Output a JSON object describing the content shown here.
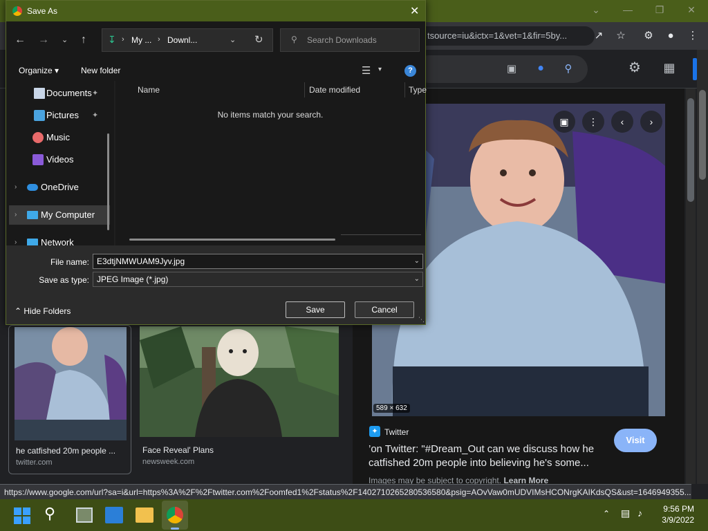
{
  "browser": {
    "omnibox_text": "tsource=iu&ictx=1&vet=1&fir=5by...",
    "status_url": "https://www.google.com/url?sa=i&url=https%3A%2F%2Ftwitter.com%2Foomfed1%2Fstatus%2F1402710265280536580&psig=AOvVaw0mUDVIMsHCONrgKAIKdsQS&ust=1646949355...",
    "accent_color": "#4a5e1a"
  },
  "results": [
    {
      "title": "he catfished 20m people ...",
      "source": "twitter.com"
    },
    {
      "title": "Face Reveal' Plans",
      "source": "newsweek.com"
    }
  ],
  "preview": {
    "dimensions": "589 × 632",
    "source_name": "Twitter",
    "title_line1": "’on Twitter: \"#Dream_Out can we discuss how he",
    "title_line2": "catfished 20m people into believing he's some...",
    "copyright_text": "Images may be subject to copyright.",
    "learn_more": "Learn More",
    "visit_label": "Visit"
  },
  "dialog": {
    "title": "Save As",
    "path": [
      "My ...",
      "Downl..."
    ],
    "search_placeholder": "Search Downloads",
    "organize_label": "Organize",
    "new_folder_label": "New folder",
    "nav_items": [
      {
        "label": "Documents",
        "icon": "documents-icon"
      },
      {
        "label": "Pictures",
        "icon": "pictures-icon"
      },
      {
        "label": "Music",
        "icon": "music-icon"
      },
      {
        "label": "Videos",
        "icon": "videos-icon"
      },
      {
        "label": "OneDrive",
        "icon": "onedrive-icon"
      },
      {
        "label": "My Computer",
        "icon": "computer-icon"
      },
      {
        "label": "Network",
        "icon": "network-icon"
      }
    ],
    "columns": [
      "Name",
      "Date modified",
      "Type"
    ],
    "empty_message": "No items match your search.",
    "file_name_label": "File name:",
    "file_name_value": "E3dtjNMWUAM9Jyv.jpg",
    "save_type_label": "Save as type:",
    "save_type_value": "JPEG Image (*.jpg)",
    "hide_folders_label": "Hide Folders",
    "save_label": "Save",
    "cancel_label": "Cancel"
  },
  "taskbar": {
    "time": "9:56 PM",
    "date": "3/9/2022"
  }
}
